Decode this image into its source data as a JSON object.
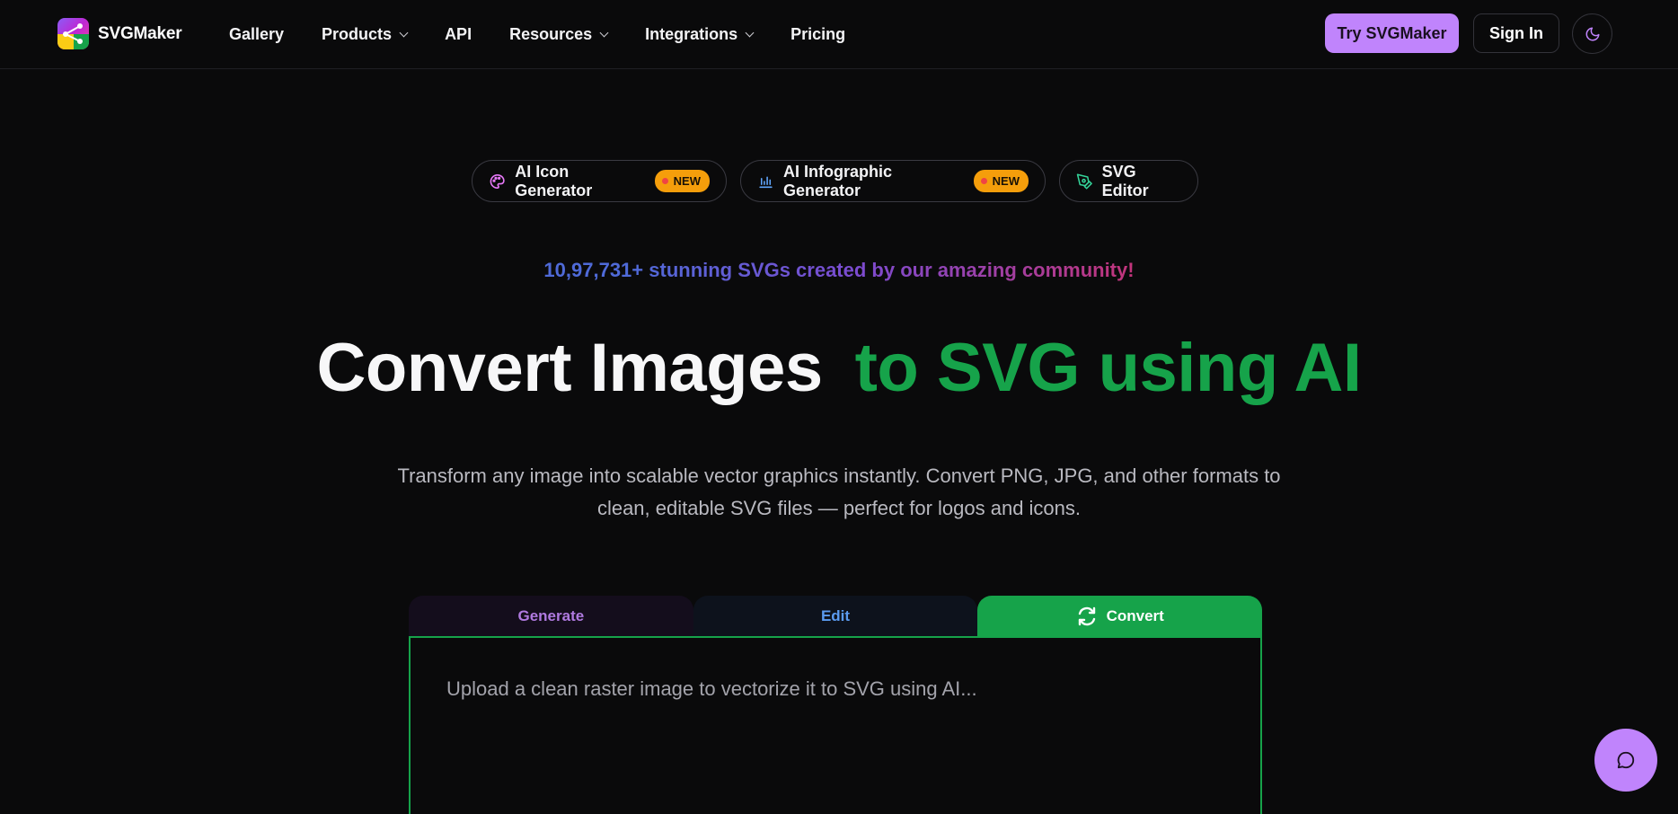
{
  "brand": {
    "name": "SVGMaker"
  },
  "nav": {
    "items": [
      {
        "label": "Gallery",
        "dropdown": false
      },
      {
        "label": "Products",
        "dropdown": true
      },
      {
        "label": "API",
        "dropdown": false
      },
      {
        "label": "Resources",
        "dropdown": true
      },
      {
        "label": "Integrations",
        "dropdown": true
      },
      {
        "label": "Pricing",
        "dropdown": false
      }
    ]
  },
  "header": {
    "try_label": "Try SVGMaker",
    "signin_label": "Sign In",
    "theme_icon": "moon-icon"
  },
  "pills": [
    {
      "label": "AI Icon Generator",
      "icon": "palette-icon",
      "badge": "NEW"
    },
    {
      "label": "AI Infographic Generator",
      "icon": "bar-chart-icon",
      "badge": "NEW"
    },
    {
      "label": "SVG Editor",
      "icon": "pen-tool-icon",
      "badge": ""
    }
  ],
  "community": {
    "count": "10,97,731",
    "text": "+ stunning SVGs created by our amazing community!"
  },
  "hero": {
    "title_white": "Convert Images",
    "title_green": "to SVG using AI",
    "subtitle": "Transform any image into scalable vector graphics instantly. Convert PNG, JPG, and other formats to clean, editable SVG files — perfect for logos and icons."
  },
  "tabs": {
    "generate": "Generate",
    "edit": "Edit",
    "convert": "Convert",
    "active": "convert"
  },
  "converter": {
    "placeholder": "Upload a clean raster image to vectorize it to SVG using AI..."
  },
  "colors": {
    "background": "#0a0a0b",
    "accent_purple": "#c084fc",
    "accent_green": "#16a34a",
    "badge_orange": "#f59e0b"
  }
}
